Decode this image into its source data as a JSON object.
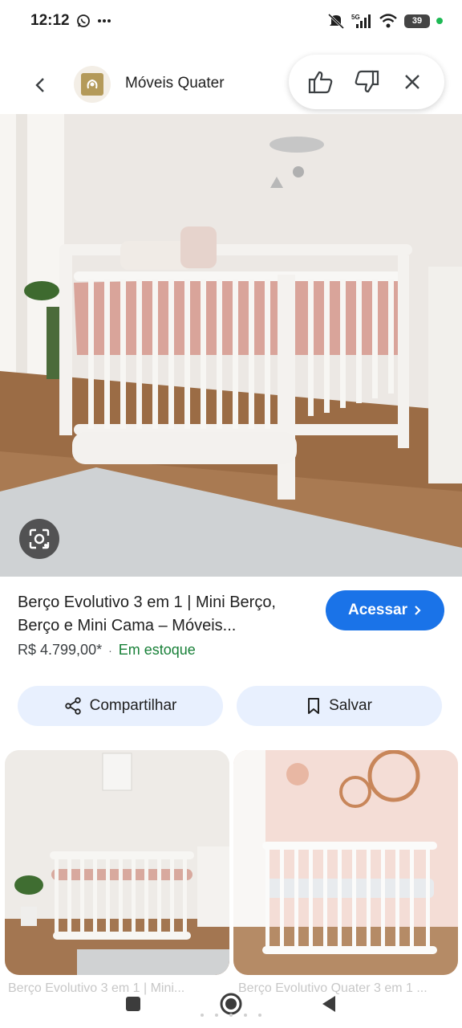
{
  "status_bar": {
    "time": "12:12",
    "network": "5G",
    "battery": "39"
  },
  "header": {
    "site_name": "Móveis Quater"
  },
  "product": {
    "title_line1": "Berço Evolutivo 3 em 1 | Mini Berço,",
    "title_line2": "Berço e Mini Cama – Móveis...",
    "price": "R$ 4.799,00*",
    "separator": "·",
    "stock": "Em estoque",
    "visit_label": "Acessar"
  },
  "actions": {
    "share_label": "Compartilhar",
    "save_label": "Salvar"
  },
  "related": [
    {
      "caption": "Berço Evolutivo 3 em 1 | Mini..."
    },
    {
      "caption": "Berço Evolutivo Quater 3 em 1 ..."
    }
  ],
  "colors": {
    "accent": "#1a73e8",
    "stock": "#188038",
    "action_bg": "#e8f0fe"
  }
}
